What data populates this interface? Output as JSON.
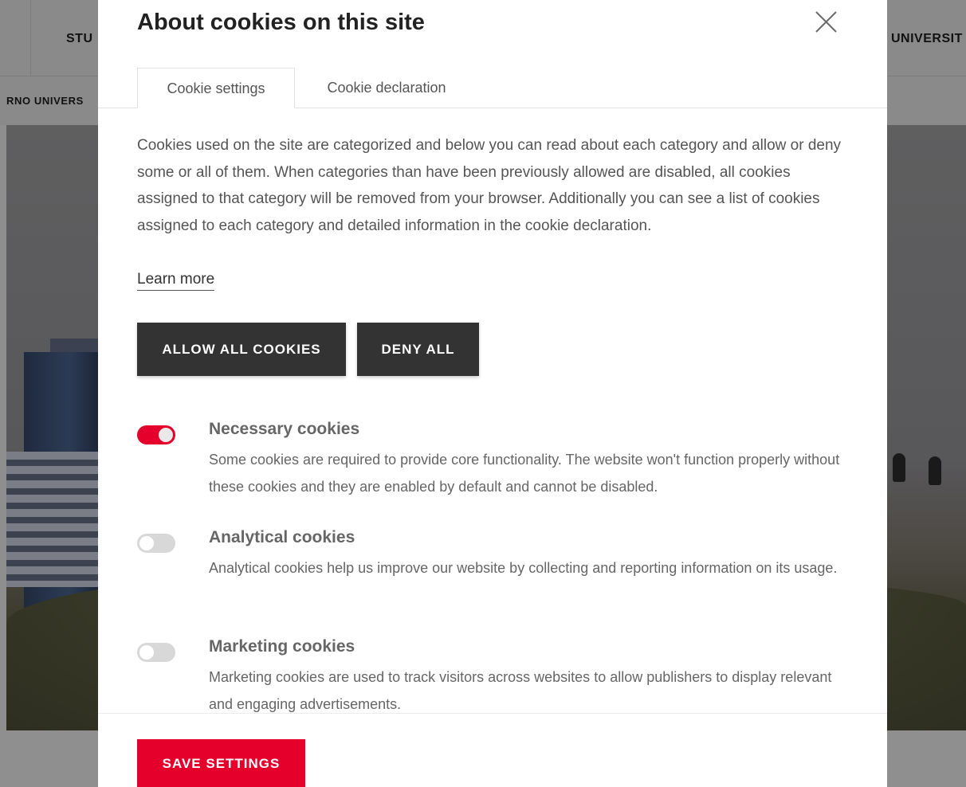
{
  "background_site": {
    "nav_left": "STU",
    "nav_right": "UNIVERSIT",
    "subnav_left": "RNO UNIVERS"
  },
  "modal": {
    "title": "About cookies on this site",
    "close_icon": "close-icon",
    "tabs": [
      {
        "label": "Cookie settings",
        "active": true
      },
      {
        "label": "Cookie declaration",
        "active": false
      }
    ],
    "intro": "Cookies used on the site are categorized and below you can read about each category and allow or deny some or all of them. When categories than have been previously allowed are disabled, all cookies assigned to that category will be removed from your browser. Additionally you can see a list of cookies assigned to each category and detailed information in the cookie declaration.",
    "learn_more": "Learn more",
    "allow_all": "ALLOW ALL COOKIES",
    "deny_all": "DENY ALL",
    "categories": [
      {
        "title": "Necessary cookies",
        "description": "Some cookies are required to provide core functionality. The website won't function properly without these cookies and they are enabled by default and cannot be disabled.",
        "enabled": true
      },
      {
        "title": "Analytical cookies",
        "description": "Analytical cookies help us improve our website by collecting and reporting information on its usage.",
        "enabled": false
      },
      {
        "title": "Marketing cookies",
        "description": "Marketing cookies are used to track visitors across websites to allow publishers to display relevant and engaging advertisements.",
        "enabled": false
      }
    ],
    "save_settings": "SAVE SETTINGS"
  },
  "colors": {
    "accent": "#e4002b",
    "dark_button": "#333333",
    "toggle_off": "#d8d8d8"
  }
}
